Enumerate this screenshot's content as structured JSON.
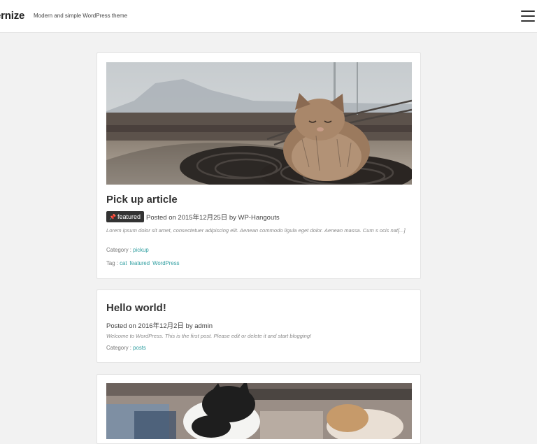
{
  "header": {
    "site_title": "ernize",
    "site_description": "Modern and simple WordPress theme"
  },
  "posts": [
    {
      "title": "Pick up article",
      "badge": "featured",
      "posted_label": "Posted on 2015年12月25日 by WP-Hangouts",
      "excerpt": "Lorem ipsum dolor sit amet, consectetuer adipiscing elit. Aenean commodo ligula eget dolor. Aenean massa. Cum s ocis nat[...]",
      "category_label": "Category :",
      "categories": [
        "pickup"
      ],
      "tag_label": "Tag :",
      "tags": [
        "cat",
        "featured",
        "WordPress"
      ]
    },
    {
      "title": "Hello world!",
      "posted_label": "Posted on 2016年12月2日 by admin",
      "excerpt": "Welcome to WordPress. This is the first post. Please edit or delete it and start blogging!",
      "category_label": "Category :",
      "categories": [
        "posts"
      ]
    }
  ],
  "colors": {
    "link": "#2f9ea0",
    "background": "#f2f2f2",
    "badge": "#333333"
  },
  "icons": [
    "pin-icon",
    "hamburger-menu-icon"
  ]
}
